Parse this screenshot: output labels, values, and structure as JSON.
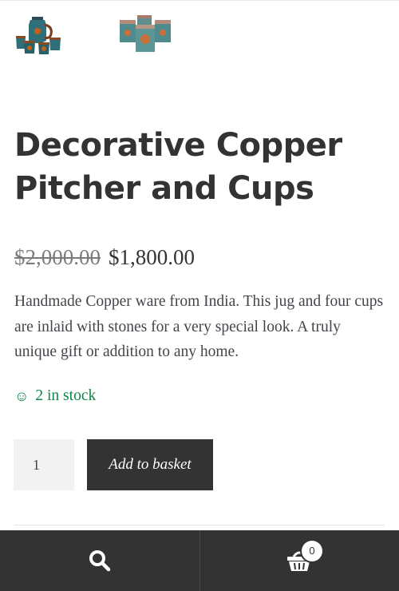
{
  "product": {
    "title": "Decorative Copper Pitcher and Cups",
    "price_old": "$2,000.00",
    "price_new": "$1,800.00",
    "description": "Handmade Copper ware from India. This jug and four cups are inlaid with stones for a very special look.  A truly unique gift or addition to any home.",
    "stock_icon": "smiley-icon",
    "stock_text": "2 in stock",
    "stock_color": "#0f834d"
  },
  "cart_form": {
    "quantity": "1",
    "add_label": "Add to basket"
  },
  "footer": {
    "search_icon": "search-icon",
    "cart_icon": "basket-icon",
    "cart_count": "0"
  },
  "thumbnails": [
    {
      "icon": "copper-pitcher-set-thumbnail"
    },
    {
      "icon": "copper-cups-thumbnail"
    }
  ]
}
